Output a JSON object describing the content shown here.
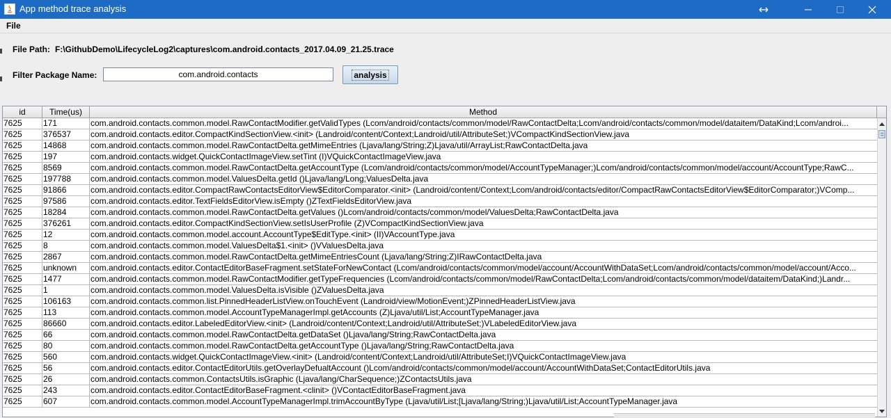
{
  "window": {
    "title": "App method trace analysis",
    "icons": [
      "java-app-icon",
      "resize-icon",
      "minimize-icon",
      "maximize-icon",
      "close-icon"
    ]
  },
  "menu": {
    "file": "File"
  },
  "file_path": {
    "label": "File Path:",
    "value": "F:\\GithubDemo\\LifecycleLog2\\captures\\com.android.contacts_2017.04.09_21.25.trace"
  },
  "filter": {
    "label": "Filter Package Name:",
    "value": "com.android.contacts",
    "button": "analysis"
  },
  "table": {
    "headers": {
      "id": "id",
      "time": "Time(us)",
      "method": "Method"
    },
    "rows": [
      {
        "id": "7625",
        "time": "171",
        "method": "com.android.contacts.common.model.RawContactModifier.getValidTypes (Lcom/android/contacts/common/model/RawContactDelta;Lcom/android/contacts/common/model/dataitem/DataKind;Lcom/androi..."
      },
      {
        "id": "7625",
        "time": "376537",
        "method": "com.android.contacts.editor.CompactKindSectionView.<init> (Landroid/content/Context;Landroid/util/AttributeSet;)VCompactKindSectionView.java"
      },
      {
        "id": "7625",
        "time": "14868",
        "method": "com.android.contacts.common.model.RawContactDelta.getMimeEntries (Ljava/lang/String;Z)Ljava/util/ArrayList;RawContactDelta.java"
      },
      {
        "id": "7625",
        "time": "197",
        "method": "com.android.contacts.widget.QuickContactImageView.setTint (I)VQuickContactImageView.java"
      },
      {
        "id": "7625",
        "time": "8569",
        "method": "com.android.contacts.common.model.RawContactDelta.getAccountType (Lcom/android/contacts/common/model/AccountTypeManager;)Lcom/android/contacts/common/model/account/AccountType;RawC..."
      },
      {
        "id": "7625",
        "time": "197788",
        "method": "com.android.contacts.common.model.ValuesDelta.getId ()Ljava/lang/Long;ValuesDelta.java"
      },
      {
        "id": "7625",
        "time": "91866",
        "method": "com.android.contacts.editor.CompactRawContactsEditorView$EditorComparator.<init> (Landroid/content/Context;Lcom/android/contacts/editor/CompactRawContactsEditorView$EditorComparator;)VComp..."
      },
      {
        "id": "7625",
        "time": "97586",
        "method": "com.android.contacts.editor.TextFieldsEditorView.isEmpty ()ZTextFieldsEditorView.java"
      },
      {
        "id": "7625",
        "time": "18284",
        "method": "com.android.contacts.common.model.RawContactDelta.getValues ()Lcom/android/contacts/common/model/ValuesDelta;RawContactDelta.java"
      },
      {
        "id": "7625",
        "time": "376261",
        "method": "com.android.contacts.editor.CompactKindSectionView.setIsUserProfile (Z)VCompactKindSectionView.java"
      },
      {
        "id": "7625",
        "time": "12",
        "method": "com.android.contacts.common.model.account.AccountType$EditType.<init> (II)VAccountType.java"
      },
      {
        "id": "7625",
        "time": "8",
        "method": "com.android.contacts.common.model.ValuesDelta$1.<init> ()VValuesDelta.java"
      },
      {
        "id": "7625",
        "time": "2867",
        "method": "com.android.contacts.common.model.RawContactDelta.getMimeEntriesCount (Ljava/lang/String;Z)IRawContactDelta.java"
      },
      {
        "id": "7625",
        "time": "unknown",
        "method": "com.android.contacts.editor.ContactEditorBaseFragment.setStateForNewContact (Lcom/android/contacts/common/model/account/AccountWithDataSet;Lcom/android/contacts/common/model/account/Acco..."
      },
      {
        "id": "7625",
        "time": "1477",
        "method": "com.android.contacts.common.model.RawContactModifier.getTypeFrequencies (Lcom/android/contacts/common/model/RawContactDelta;Lcom/android/contacts/common/model/dataitem/DataKind;)Landr..."
      },
      {
        "id": "7625",
        "time": "1",
        "method": "com.android.contacts.common.model.ValuesDelta.isVisible ()ZValuesDelta.java"
      },
      {
        "id": "7625",
        "time": "106163",
        "method": "com.android.contacts.common.list.PinnedHeaderListView.onTouchEvent (Landroid/view/MotionEvent;)ZPinnedHeaderListView.java"
      },
      {
        "id": "7625",
        "time": "113",
        "method": "com.android.contacts.common.model.AccountTypeManagerImpl.getAccounts (Z)Ljava/util/List;AccountTypeManager.java"
      },
      {
        "id": "7625",
        "time": "86660",
        "method": "com.android.contacts.editor.LabeledEditorView.<init> (Landroid/content/Context;Landroid/util/AttributeSet;)VLabeledEditorView.java"
      },
      {
        "id": "7625",
        "time": "66",
        "method": "com.android.contacts.common.model.RawContactDelta.getDataSet ()Ljava/lang/String;RawContactDelta.java"
      },
      {
        "id": "7625",
        "time": "80",
        "method": "com.android.contacts.common.model.RawContactDelta.getAccountType ()Ljava/lang/String;RawContactDelta.java"
      },
      {
        "id": "7625",
        "time": "560",
        "method": "com.android.contacts.widget.QuickContactImageView.<init> (Landroid/content/Context;Landroid/util/AttributeSet;I)VQuickContactImageView.java"
      },
      {
        "id": "7625",
        "time": "56",
        "method": "com.android.contacts.editor.ContactEditorUtils.getOverlayDefualtAccount ()Lcom/android/contacts/common/model/account/AccountWithDataSet;ContactEditorUtils.java"
      },
      {
        "id": "7625",
        "time": "26",
        "method": "com.android.contacts.common.ContactsUtils.isGraphic (Ljava/lang/CharSequence;)ZContactsUtils.java"
      },
      {
        "id": "7625",
        "time": "243",
        "method": "com.android.contacts.editor.ContactEditorBaseFragment.<clinit> ()VContactEditorBaseFragment.java"
      },
      {
        "id": "7625",
        "time": "607",
        "method": "com.android.contacts.common.model.AccountTypeManagerImpl.trimAccountByType (Ljava/util/List;[Ljava/lang/String;)Ljava/util/List;AccountTypeManager.java"
      }
    ]
  },
  "colors": {
    "titlebar": "#1e6bc6",
    "window_bg": "#eeeeee",
    "grid_line": "#b8b8b8"
  }
}
